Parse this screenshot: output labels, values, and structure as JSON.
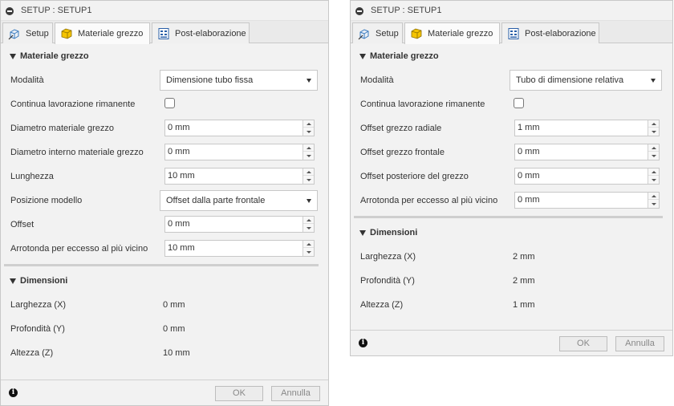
{
  "dialogs": [
    {
      "title": "SETUP : SETUP1",
      "tabs": [
        {
          "label": "Setup"
        },
        {
          "label": "Materiale grezzo"
        },
        {
          "label": "Post-elaborazione"
        }
      ],
      "stock_section": "Materiale grezzo",
      "rows": {
        "mode": {
          "label": "Modalità",
          "value": "Dimensione tubo fissa"
        },
        "continue": {
          "label": "Continua lavorazione rimanente",
          "checked": false
        },
        "diameter": {
          "label": "Diametro materiale grezzo",
          "value": "0 mm"
        },
        "inner_diameter": {
          "label": "Diametro interno materiale grezzo",
          "value": "0 mm"
        },
        "length": {
          "label": "Lunghezza",
          "value": "10 mm"
        },
        "model_position": {
          "label": "Posizione modello",
          "value": "Offset dalla parte frontale"
        },
        "offset": {
          "label": "Offset",
          "value": "0 mm"
        },
        "round_up": {
          "label": "Arrotonda per eccesso al più vicino",
          "value": "10 mm"
        }
      },
      "dims_section": "Dimensioni",
      "dims": {
        "width": {
          "label": "Larghezza (X)",
          "value": "0 mm"
        },
        "depth": {
          "label": "Profondità (Y)",
          "value": "0 mm"
        },
        "height": {
          "label": "Altezza (Z)",
          "value": "10 mm"
        }
      },
      "buttons": {
        "ok": "OK",
        "cancel": "Annulla"
      }
    },
    {
      "title": "SETUP : SETUP1",
      "tabs": [
        {
          "label": "Setup"
        },
        {
          "label": "Materiale grezzo"
        },
        {
          "label": "Post-elaborazione"
        }
      ],
      "stock_section": "Materiale grezzo",
      "rows": {
        "mode": {
          "label": "Modalità",
          "value": "Tubo di dimensione relativa"
        },
        "continue": {
          "label": "Continua lavorazione rimanente",
          "checked": false
        },
        "radial_offset": {
          "label": "Offset grezzo radiale",
          "value": "1 mm"
        },
        "front_offset": {
          "label": "Offset grezzo frontale",
          "value": "0 mm"
        },
        "back_offset": {
          "label": "Offset posteriore del grezzo",
          "value": "0 mm"
        },
        "round_up": {
          "label": "Arrotonda per eccesso al più vicino",
          "value": "0 mm"
        }
      },
      "dims_section": "Dimensioni",
      "dims": {
        "width": {
          "label": "Larghezza (X)",
          "value": "2 mm"
        },
        "depth": {
          "label": "Profondità (Y)",
          "value": "2 mm"
        },
        "height": {
          "label": "Altezza (Z)",
          "value": "1 mm"
        }
      },
      "buttons": {
        "ok": "OK",
        "cancel": "Annulla"
      }
    }
  ],
  "icons": {
    "setup_tab": "setup-icon",
    "stock_tab": "stock-cube-icon",
    "post_tab": "post-process-icon",
    "collapse": "collapse-triangle-icon",
    "info": "info-icon",
    "title": "minimize-circle-icon"
  },
  "colors": {
    "stock_cube": "#f5c400",
    "setup_icon": "#3a7bbf",
    "post_icon": "#2a5fa8"
  }
}
